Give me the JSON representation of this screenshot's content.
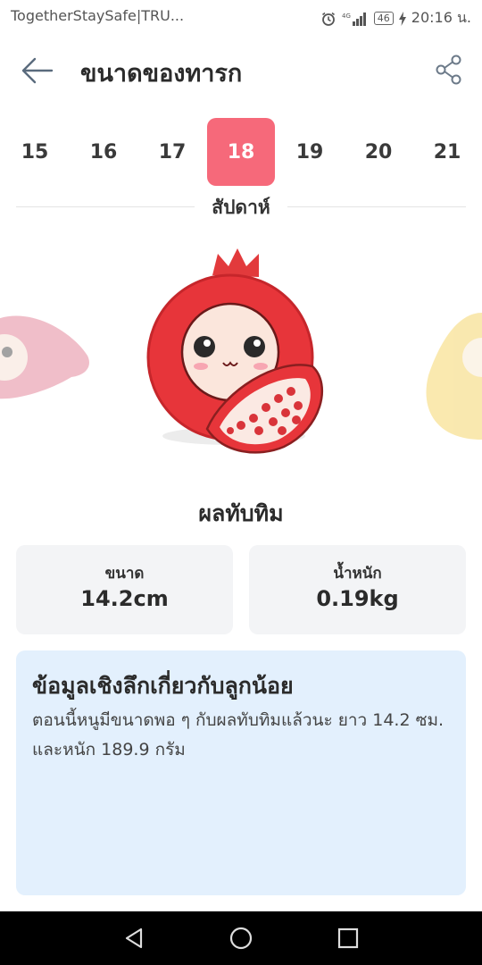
{
  "status_bar": {
    "notification_text": "TogetherStaySafe|TRU...",
    "network": "4G",
    "battery": "46",
    "time": "20:16 น."
  },
  "header": {
    "title": "ขนาดของทารก",
    "back_icon": "arrow-left-icon",
    "share_icon": "share-icon"
  },
  "weeks": {
    "items": [
      "15",
      "16",
      "17",
      "18",
      "19",
      "20",
      "21"
    ],
    "selected": "18",
    "label": "สัปดาห์"
  },
  "fruit": {
    "name": "ผลทับทิม",
    "colors": {
      "fruit": "#e8363a",
      "face": "#fbe6dc",
      "cheek": "#f7a6b2"
    }
  },
  "stats": {
    "size": {
      "label": "ขนาด",
      "value": "14.2cm"
    },
    "weight": {
      "label": "น้ำหนัก",
      "value": "0.19kg"
    }
  },
  "insight": {
    "title": "ข้อมูลเชิงลึกเกี่ยวกับลูกน้อย",
    "text": "ตอนนี้หนูมีขนาดพอ ๆ กับผลทับทิมแล้วนะ ยาว 14.2 ซม. และหนัก 189.9 กรัม"
  },
  "theme": {
    "accent": "#f6697a",
    "info_bg": "#e3f0fd",
    "card_bg": "#f3f4f6"
  },
  "nav_bar": {
    "back_icon": "triangle-back-icon",
    "home_icon": "circle-home-icon",
    "recents_icon": "square-recents-icon"
  }
}
